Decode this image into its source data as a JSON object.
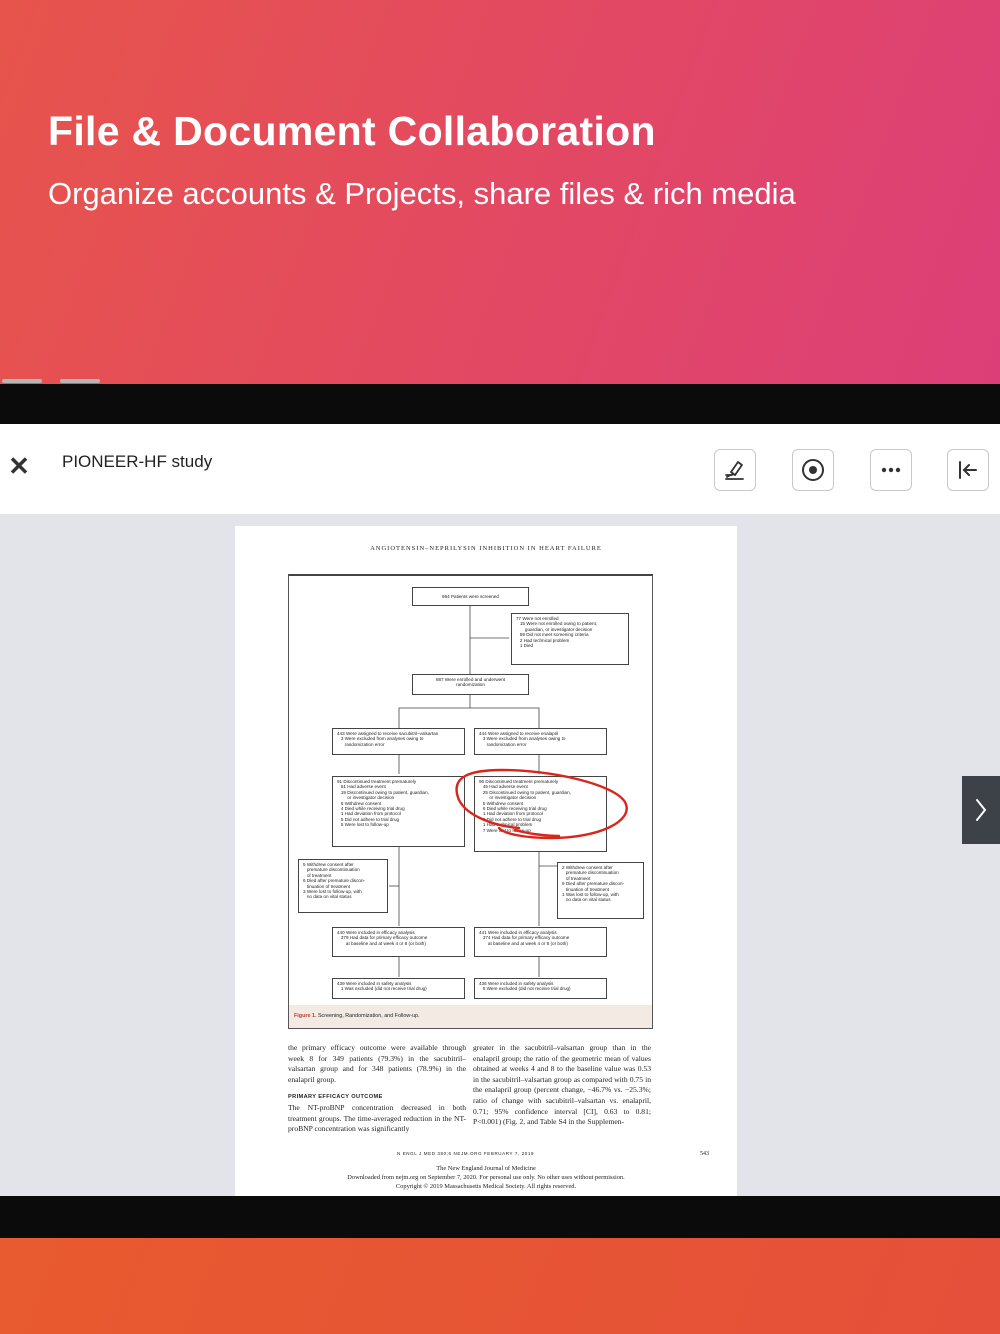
{
  "hero": {
    "title": "File & Document Collaboration",
    "subtitle": "Organize accounts & Projects, share files & rich media"
  },
  "toolbar": {
    "close_icon": "close-icon",
    "document_title": "PIONEER-HF study",
    "buttons": [
      "annotate-pen-icon",
      "record-circle-icon",
      "more-dots-icon",
      "collapse-left-icon"
    ]
  },
  "page": {
    "running_head": "ANGIOTENSIN–NEPRILYSIN INHIBITION IN HEART FAILURE",
    "flowchart": {
      "screened": "964 Patients were screened",
      "not_enrolled": "77 Were not enrolled\n   15 Were not enrolled owing to patient,\n       guardian, or investigator decision\n   59 Did not meet screening criteria\n   2 Had technical problem\n   1 Died",
      "enrolled": "887 Were enrolled and underwent\nrandomization",
      "assigned_left": "443 Were assigned to receive sacubitril–valsartan\n   3 Were excluded from analyses owing to\n      randomization error",
      "assigned_right": "444 Were assigned to receive enalapril\n   3 Were excluded from analyses owing to\n      randomization error",
      "discontinued_left": "91 Discontinued treatment prematurely\n   51 Had adverse event\n   19 Discontinued owing to patient, guardian,\n        or investigator decision\n   6 Withdrew consent\n   4 Died while receiving trial drug\n   1 Had deviation from protocol\n   5 Did not adhere to trial drug\n   5 Were lost to follow-up",
      "discontinued_right": "96 Discontinued treatment prematurely\n   45 Had adverse event\n   25 Discontinued owing to patient, guardian,\n        or investigator decision\n   5 Withdrew consent\n   6 Died while receiving trial drug\n   1 Had deviation from protocol\n   6 Did not adhere to trial drug\n   1 Had technical problem\n   7 Were lost to follow-up",
      "side_left": "5 Withdrew consent after\n   premature discontinuation\n   of treatment\n6 Died after premature discon-\n   tinuation of treatment\n3 Were lost to follow-up, with\n   no data on vital status",
      "side_right": "2 Withdrew consent after\n   premature discontinuation\n   of treatment\n9 Died after premature discon-\n   tinuation of treatment\n1 Was lost to follow-up, with\n   no data on vital status",
      "efficacy_left": "440 Were included in efficacy analysis\n   379 Had data for primary efficacy outcome\n       at baseline and at week 4 or 8 (or both)",
      "efficacy_right": "441 Were included in efficacy analysis\n   374 Had data for primary efficacy outcome\n       at baseline and at week 4 or 8 (or both)",
      "safety_left": "439 Were included in safety analysis\n   1 Was excluded (did not receive trial drug)",
      "safety_right": "436 Were included in safety analysis\n   5 Were excluded (did not receive trial drug)",
      "caption_label": "Figure 1.",
      "caption_text": " Screening, Randomization, and Follow-up."
    },
    "body_left": "the primary efficacy outcome were available through week 8 for 349 patients (79.3%) in the sacubitril–valsartan group and for 348 patients (78.9%) in the enalapril group.",
    "section_head": "PRIMARY EFFICACY OUTCOME",
    "body_left_2": "The NT-proBNP concentration decreased in both treatment groups. The time-averaged reduction in the NT-proBNP concentration was significantly",
    "body_right": "greater in the sacubitril–valsartan group than in the enalapril group; the ratio of the geometric mean of values obtained at weeks 4 and 8 to the baseline value was 0.53 in the sacubitril–valsartan group as compared with 0.75 in the enalapril group (percent change, −46.7% vs. −25.3%; ratio of change with sacubitril–valsartan vs. enalapril, 0.71; 95% confidence interval [CI], 0.63 to 0.81; P<0.001) (Fig. 2, and Table S4 in the Supplemen-",
    "folio": "N ENGL J MED 380;6   NEJM.ORG   FEBRUARY 7, 2019",
    "page_number": "543",
    "footnote_1": "The New England Journal of Medicine",
    "footnote_2": "Downloaded from nejm.org on September 7, 2020. For personal use only. No other uses without permission.",
    "footnote_3": "Copyright © 2019 Massachusetts Medical Society. All rights reserved."
  },
  "colors": {
    "hero_start": "#e7544b",
    "hero_end": "#dc3f78",
    "annotation_red": "#d9261c"
  },
  "next_page_icon": "chevron-right-icon"
}
